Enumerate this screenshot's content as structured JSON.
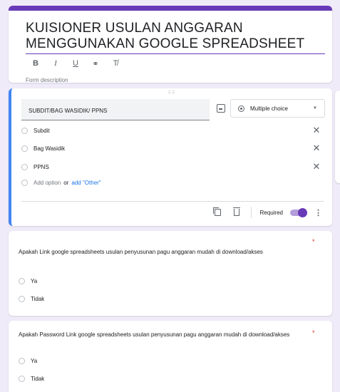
{
  "form": {
    "title": "KUISIONER USULAN ANGGARAN MENGGUNAKAN GOOGLE SPREADSHEET",
    "toolbar": {
      "bold": "B",
      "italic": "I",
      "underline": "U",
      "link": "⚭",
      "clear": "T̸"
    },
    "description_placeholder": "Form description"
  },
  "question1": {
    "drag_handle": "⠿⠿",
    "title": "SUBDIT/BAG WASIDIK/ PPNS",
    "type": "Multiple choice",
    "options": [
      "Subdit",
      "Bag Wasidik",
      "PPNS"
    ],
    "add_option": "Add option",
    "or": "or",
    "add_other": "add \"Other\"",
    "required_label": "Required",
    "remove_glyph": "✕"
  },
  "question2": {
    "title": "Apakah Link google spreadsheets usulan penyusunan pagu anggaran mudah di download/akses",
    "required_mark": "*",
    "options": [
      "Ya",
      "Tidak"
    ]
  },
  "question3": {
    "title": "Apakah Password Link google spreadsheets usulan penyusunan pagu anggaran mudah di download/akses",
    "required_mark": "*",
    "options": [
      "Ya",
      "Tidak"
    ]
  },
  "colors": {
    "accent": "#673ab7",
    "active_border": "#4285f4",
    "background": "#f0ebf8",
    "required": "#d93025",
    "link": "#1a73e8"
  }
}
